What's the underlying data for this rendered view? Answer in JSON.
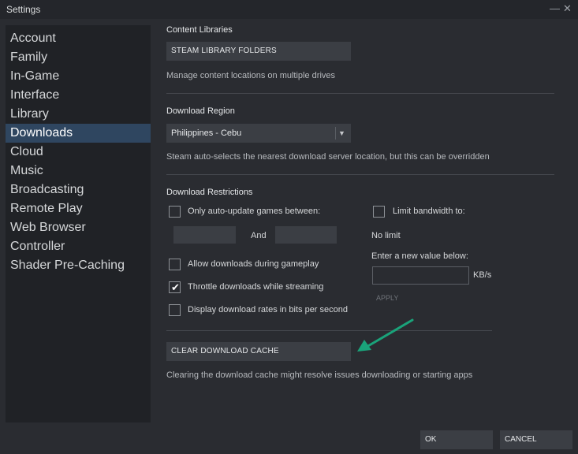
{
  "window": {
    "title": "Settings",
    "minimize_glyph": "—",
    "close_glyph": "✕"
  },
  "sidebar": {
    "items": [
      {
        "label": "Account"
      },
      {
        "label": "Family"
      },
      {
        "label": "In-Game"
      },
      {
        "label": "Interface"
      },
      {
        "label": "Library"
      },
      {
        "label": "Downloads",
        "active": true
      },
      {
        "label": "Cloud"
      },
      {
        "label": "Music"
      },
      {
        "label": "Broadcasting"
      },
      {
        "label": "Remote Play"
      },
      {
        "label": "Web Browser"
      },
      {
        "label": "Controller"
      },
      {
        "label": "Shader Pre-Caching"
      }
    ]
  },
  "content_libraries": {
    "title": "Content Libraries",
    "button_label": "STEAM LIBRARY FOLDERS",
    "description": "Manage content locations on multiple drives"
  },
  "download_region": {
    "title": "Download Region",
    "selected": "Philippines - Cebu",
    "description": "Steam auto-selects the nearest download server location, but this can be overridden"
  },
  "download_restrictions": {
    "title": "Download Restrictions",
    "auto_update": {
      "label": "Only auto-update games between:",
      "checked": false,
      "start": "",
      "end": "",
      "and_label": "And"
    },
    "allow_gameplay": {
      "label": "Allow downloads during gameplay",
      "checked": false
    },
    "throttle_streaming": {
      "label": "Throttle downloads while streaming",
      "checked": true
    },
    "bits_per_second": {
      "label": "Display download rates in bits per second",
      "checked": false
    },
    "limit_bandwidth": {
      "label": "Limit bandwidth to:",
      "checked": false
    },
    "no_limit": "No limit",
    "enter_value": "Enter a new value below:",
    "value": "",
    "unit": "KB/s",
    "apply_label": "APPLY"
  },
  "cache": {
    "button_label": "CLEAR DOWNLOAD CACHE",
    "description": "Clearing the download cache might resolve issues downloading or starting apps"
  },
  "annotation": {
    "color": "#1aa37a"
  },
  "footer": {
    "ok_label": "OK",
    "cancel_label": "CANCEL"
  },
  "colors": {
    "accent_active": "#2f4660",
    "background": "#2a2c31",
    "sidebar": "#202226"
  }
}
